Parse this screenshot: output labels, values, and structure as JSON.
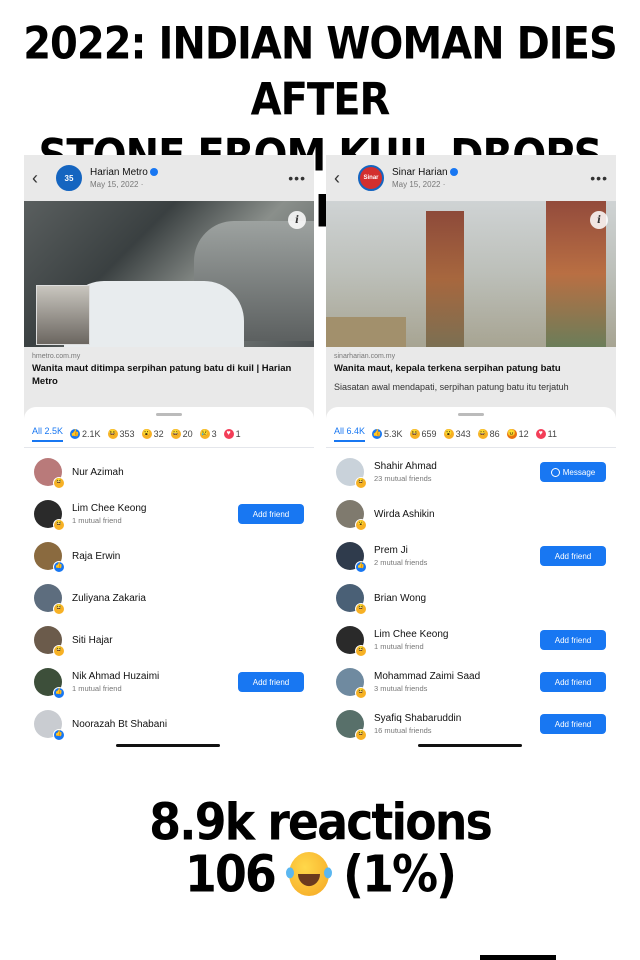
{
  "headline": {
    "line1": "2022: INDIAN WOMAN DIES AFTER",
    "line2": "STONE FROM KUIL DROPS ON HER"
  },
  "left": {
    "page_name": "Harian Metro",
    "post_date": "May 15, 2022 · ",
    "logo_text": "35",
    "link_domain": "hmetro.com.my",
    "link_title": "Wanita maut ditimpa serpihan patung batu di kuil | Harian Metro",
    "tabs": {
      "all": "All 2.5K",
      "like": "2.1K",
      "haha": "353",
      "wow": "32",
      "care": "20",
      "sad": "3",
      "love": "1"
    },
    "people": [
      {
        "name": "Nur Azimah",
        "sub": "",
        "button": "",
        "badge": "haha",
        "color": "#b97a7a"
      },
      {
        "name": "Lim Chee Keong",
        "sub": "1 mutual friend",
        "button": "Add friend",
        "badge": "haha",
        "color": "#2a2a2a"
      },
      {
        "name": "Raja Erwin",
        "sub": "",
        "button": "",
        "badge": "like",
        "color": "#8a6a3f"
      },
      {
        "name": "Zuliyana Zakaria",
        "sub": "",
        "button": "",
        "badge": "haha",
        "color": "#5d6d7e"
      },
      {
        "name": "Siti Hajar",
        "sub": "",
        "button": "",
        "badge": "haha",
        "color": "#6b5b4b"
      },
      {
        "name": "Nik Ahmad Huzaimi",
        "sub": "1 mutual friend",
        "button": "Add friend",
        "badge": "like",
        "color": "#3d4f3a"
      },
      {
        "name": "Noorazah Bt Shabani",
        "sub": "",
        "button": "",
        "badge": "like",
        "color": "#c9ccd1"
      }
    ]
  },
  "right": {
    "page_name": "Sinar Harian",
    "post_date": "May 15, 2022 · ",
    "logo_text": "Sinar",
    "link_domain": "sinarharian.com.my",
    "link_title": "Wanita maut, kepala terkena serpihan patung batu",
    "link_desc": "Siasatan awal mendapati, serpihan patung batu itu terjatuh",
    "tabs": {
      "all": "All 6.4K",
      "like": "5.3K",
      "haha": "659",
      "wow": "343",
      "care": "86",
      "angry": "12",
      "love": "11"
    },
    "people": [
      {
        "name": "Shahir Ahmad",
        "sub": "23 mutual friends",
        "button": "Message",
        "badge": "haha",
        "color": "#c9d2da"
      },
      {
        "name": "Wirda Ashikin",
        "sub": "",
        "button": "",
        "badge": "wow",
        "color": "#7f7a6e"
      },
      {
        "name": "Prem Ji",
        "sub": "2 mutual friends",
        "button": "Add friend",
        "badge": "like",
        "color": "#2f3b4c"
      },
      {
        "name": "Brian Wong",
        "sub": "",
        "button": "",
        "badge": "haha",
        "color": "#4a6076"
      },
      {
        "name": "Lim Chee Keong",
        "sub": "1 mutual friend",
        "button": "Add friend",
        "badge": "haha",
        "color": "#2a2a2a"
      },
      {
        "name": "Mohammad Zaimi Saad",
        "sub": "3 mutual friends",
        "button": "Add friend",
        "badge": "haha",
        "color": "#6f8aa0"
      },
      {
        "name": "Syafiq Shabaruddin",
        "sub": "16 mutual friends",
        "button": "Add friend",
        "badge": "haha",
        "color": "#58706a"
      }
    ]
  },
  "summary": {
    "line1": "8.9k reactions",
    "count": "106",
    "percent": "(1%)"
  },
  "icons": {
    "back": "chevron-left-icon",
    "more": "more-dots-icon",
    "info": "info-icon",
    "laugh": "laughing-emoji-icon"
  }
}
